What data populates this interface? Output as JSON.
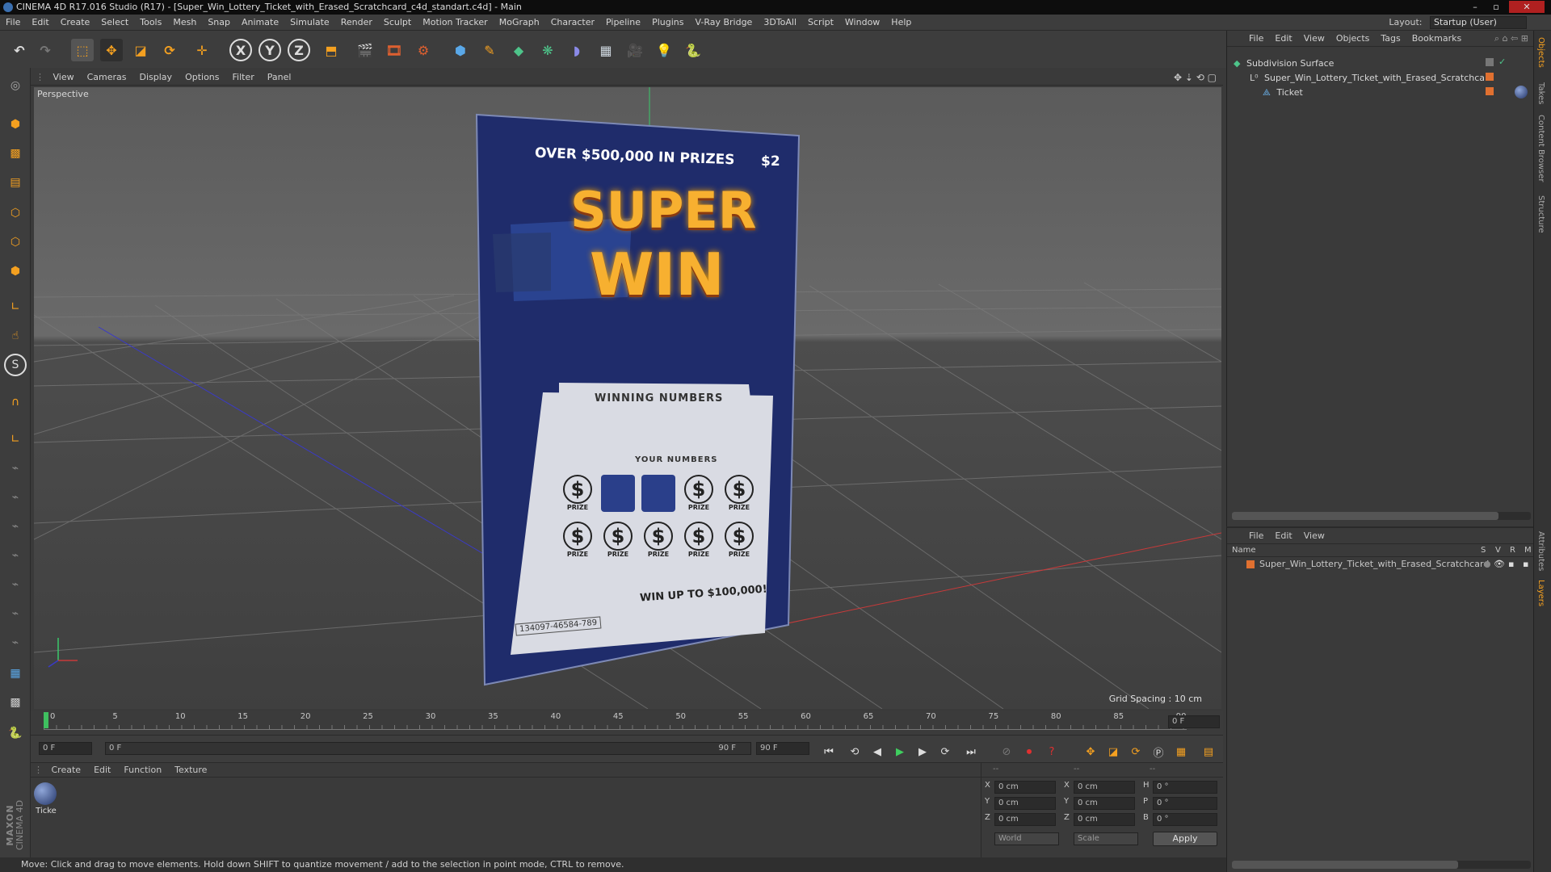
{
  "window": {
    "title": "CINEMA 4D R17.016 Studio (R17) - [Super_Win_Lottery_Ticket_with_Erased_Scratchcard_c4d_standart.c4d] - Main",
    "controls": [
      "–",
      "▫",
      "✕"
    ]
  },
  "menubar": {
    "items": [
      "File",
      "Edit",
      "Create",
      "Select",
      "Tools",
      "Mesh",
      "Snap",
      "Animate",
      "Simulate",
      "Render",
      "Sculpt",
      "Motion Tracker",
      "MoGraph",
      "Character",
      "Pipeline",
      "Plugins",
      "V-Ray Bridge",
      "3DToAll",
      "Script",
      "Window",
      "Help"
    ],
    "layout_label": "Layout:",
    "layout_value": "Startup (User)"
  },
  "toolbar": {
    "icons": [
      "undo-icon",
      "redo-icon",
      "live-selection-icon",
      "move-icon",
      "scale-icon",
      "rotate-icon",
      "transform-icon",
      "x-axis-icon",
      "y-axis-icon",
      "z-axis-icon",
      "coordinate-system-icon",
      "render-view-icon",
      "render-picture-viewer-icon",
      "edit-render-settings-icon",
      "cube-icon",
      "pen-spline-icon",
      "subdivision-nurbs-icon",
      "array-icon",
      "deformer-icon",
      "floor-icon",
      "camera-icon",
      "light-icon",
      "python-icon"
    ],
    "axis_labels": [
      "X",
      "Y",
      "Z"
    ]
  },
  "left_tools": [
    "make-editable-icon",
    "model-mode-icon",
    "texture-mode-icon",
    "workplane-mode-icon",
    "points-mode-icon",
    "edges-mode-icon",
    "polygons-mode-icon",
    "enable-axis-icon",
    "tweak-icon",
    "snap-icon",
    "magnet-icon",
    "axis-tool-icon",
    "sculpt-brush-icon",
    "sculpt-brush-icon",
    "sculpt-brush-icon",
    "sculpt-brush-icon",
    "sculpt-brush-icon",
    "sculpt-brush-icon",
    "sculpt-brush-icon",
    "workplane-lock-icon",
    "grid-icon",
    "python-icon"
  ],
  "viewport": {
    "menu": [
      "View",
      "Cameras",
      "Display",
      "Options",
      "Filter",
      "Panel"
    ],
    "label": "Perspective",
    "grid_spacing": "Grid Spacing : 10 cm",
    "ticket": {
      "top_text": "OVER $500,000 IN PRIZES",
      "price": "$2",
      "title_1": "SUPER",
      "title_2": "WIN",
      "winning_numbers": "WINNING NUMBERS",
      "your_numbers": "YOUR NUMBERS",
      "prize_symbol": "$",
      "prize_word": "PRIZE",
      "win_up_to": "WIN UP TO $100,000!",
      "serial": "134097-46584-789"
    }
  },
  "timeline": {
    "ticks": [
      "0",
      "5",
      "10",
      "15",
      "20",
      "25",
      "30",
      "35",
      "40",
      "45",
      "50",
      "55",
      "60",
      "65",
      "70",
      "75",
      "80",
      "85",
      "90"
    ],
    "current_frame": "0 F",
    "start_frame": "0 F",
    "range_start": "0 F",
    "range_end": "90 F",
    "end_frame": "90 F"
  },
  "material_manager": {
    "menu": [
      "Create",
      "Edit",
      "Function",
      "Texture"
    ],
    "materials": [
      {
        "name": "Ticke"
      }
    ]
  },
  "coordinates": {
    "headers": [
      "--",
      "--",
      "--"
    ],
    "rows": [
      {
        "a": "X",
        "av": "0 cm",
        "b": "X",
        "bv": "0 cm",
        "c": "H",
        "cv": "0 °"
      },
      {
        "a": "Y",
        "av": "0 cm",
        "b": "Y",
        "bv": "0 cm",
        "c": "P",
        "cv": "0 °"
      },
      {
        "a": "Z",
        "av": "0 cm",
        "b": "Z",
        "bv": "0 cm",
        "c": "B",
        "cv": "0 °"
      }
    ],
    "mode": "World",
    "size_mode": "Scale",
    "apply": "Apply"
  },
  "object_manager": {
    "menu": [
      "File",
      "Edit",
      "View",
      "Objects",
      "Tags",
      "Bookmarks"
    ],
    "objects": [
      {
        "name": "Subdivision Surface"
      },
      {
        "name": "Super_Win_Lottery_Ticket_with_Erased_Scratchcard"
      },
      {
        "name": "Ticket"
      }
    ]
  },
  "layer_manager": {
    "menu": [
      "File",
      "Edit",
      "View"
    ],
    "col_name": "Name",
    "col_flags": [
      "S",
      "V",
      "R",
      "M"
    ],
    "layers": [
      {
        "name": "Super_Win_Lottery_Ticket_with_Erased_Scratchcard"
      }
    ]
  },
  "side_tabs": [
    "Objects",
    "Takes",
    "Content Browser",
    "Structure"
  ],
  "side_tabs_lower": [
    "Attributes",
    "Layers"
  ],
  "status": "Move: Click and drag to move elements. Hold down SHIFT to quantize movement / add to the selection in point mode, CTRL to remove.",
  "brand": [
    "MAXON",
    "CINEMA 4D"
  ]
}
